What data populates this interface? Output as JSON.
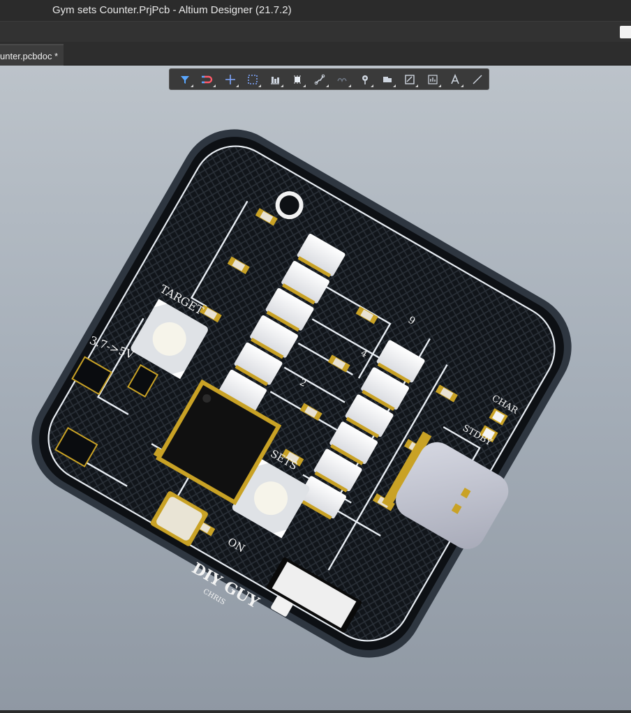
{
  "window": {
    "title": "Gym sets Counter.PrjPcb - Altium Designer (21.7.2)"
  },
  "tabs": {
    "active_document": "unter.pcbdoc *"
  },
  "toolbar": {
    "items": [
      {
        "icon": "filter-icon"
      },
      {
        "icon": "snap-magnet-icon"
      },
      {
        "icon": "crosshair-add-icon"
      },
      {
        "icon": "select-rectangle-icon"
      },
      {
        "icon": "align-icon"
      },
      {
        "icon": "component-icon"
      },
      {
        "icon": "route-icon"
      },
      {
        "icon": "diff-pair-icon"
      },
      {
        "icon": "pad-via-icon"
      },
      {
        "icon": "polygon-icon"
      },
      {
        "icon": "region-icon"
      },
      {
        "icon": "dimension-icon"
      },
      {
        "icon": "text-icon"
      },
      {
        "icon": "line-icon"
      }
    ]
  },
  "board": {
    "colors": {
      "mask": "#0d1014",
      "edge": "#2e3640",
      "trace": "#e9eef4",
      "pad_gold": "#c9a225",
      "led_body": "#f3f3f3",
      "connector": "#b9bcc9"
    },
    "silkscreen": {
      "target": "TARGET",
      "voltage": "3.7->5V",
      "sets": "SETS",
      "on": "ON",
      "charge": "CHAR",
      "standby": "STDBY",
      "logo": "DIY GUY",
      "logo_sub": "CHRIS",
      "digit_nine": "9",
      "digit_four": "4",
      "digit_two": "2"
    }
  }
}
